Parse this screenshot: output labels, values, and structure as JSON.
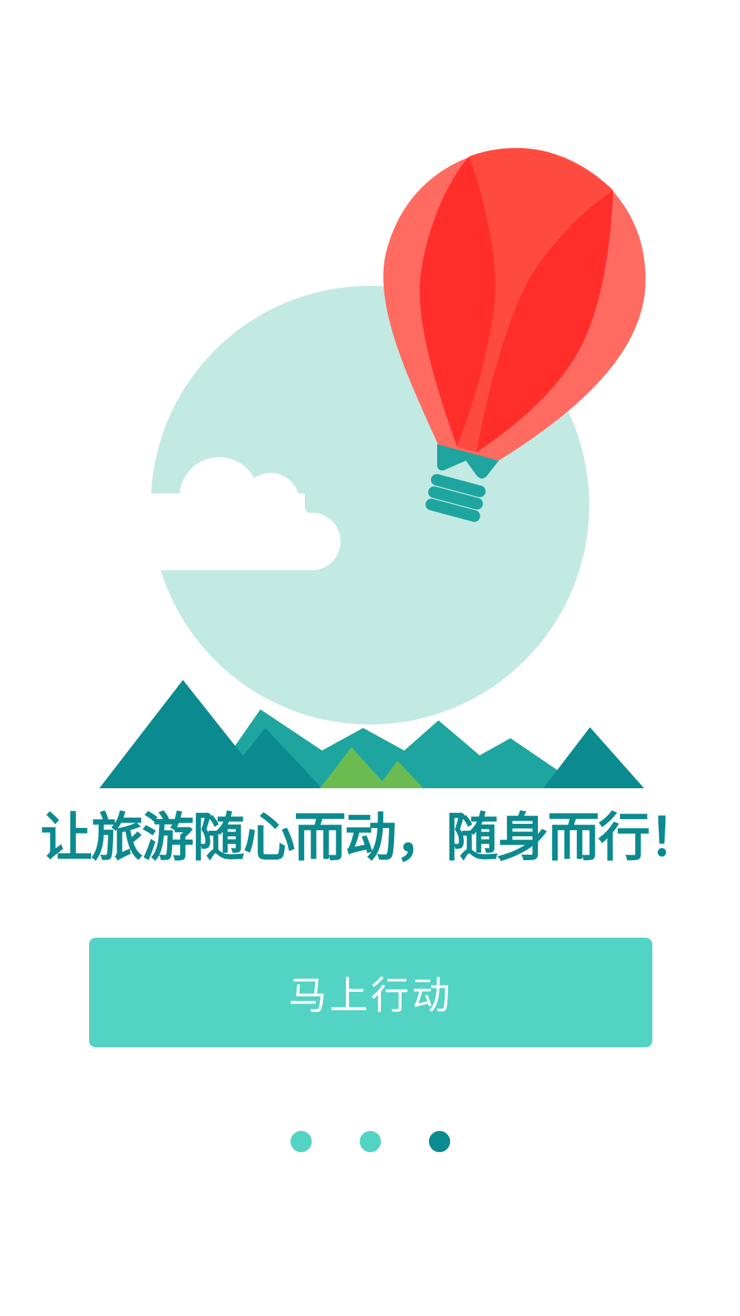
{
  "intro": {
    "slogan": "让旅游随心而动，随身而行！",
    "cta_label": "马上行动",
    "pages_total": 3,
    "current_page": 3
  },
  "colors": {
    "teal_dark": "#0b8a8f",
    "teal_mid": "#1ea59f",
    "teal_light": "#52d3c3",
    "sky_circle": "#c3e9e3",
    "balloon_red": "#ff2e2a",
    "balloon_light": "#ff6b61",
    "grass": "#6bbb51"
  },
  "icons": {
    "illustration": "hot-air-balloon-landscape"
  }
}
